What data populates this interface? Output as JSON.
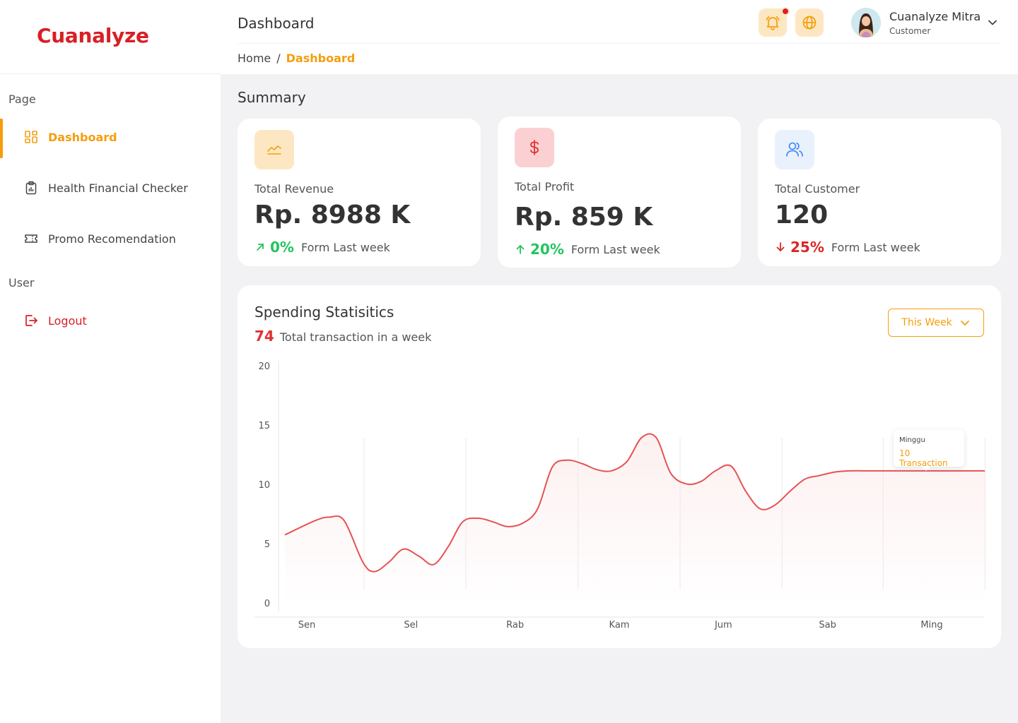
{
  "app": {
    "logo": "Cuanalyze"
  },
  "sidebar": {
    "page_section": "Page",
    "user_section": "User",
    "items": [
      {
        "label": "Dashboard",
        "icon": "dashboard-grid-icon",
        "active": true
      },
      {
        "label": "Health Financial Checker",
        "icon": "clipboard-icon"
      },
      {
        "label": "Promo Recomendation",
        "icon": "ticket-icon"
      }
    ],
    "logout": {
      "label": "Logout",
      "icon": "logout-icon"
    }
  },
  "header": {
    "title": "Dashboard",
    "breadcrumb": {
      "home": "Home",
      "separator": "/",
      "current": "Dashboard"
    },
    "user": {
      "name": "Cuanalyze Mitra",
      "role": "Customer"
    }
  },
  "summary": {
    "title": "Summary",
    "cards": [
      {
        "label": "Total Revenue",
        "value": "Rp. 8988 K",
        "change": "0%",
        "trend": "up",
        "note": "Form Last week",
        "icon": "chart-line-icon"
      },
      {
        "label": "Total Profit",
        "value": "Rp. 859 K",
        "change": "20%",
        "trend": "up",
        "note": "Form Last week",
        "icon": "dollar-icon"
      },
      {
        "label": "Total Customer",
        "value": "120",
        "change": "25%",
        "trend": "down",
        "note": "Form Last week",
        "icon": "users-icon"
      }
    ]
  },
  "stats": {
    "title": "Spending Statisitics",
    "total": "74",
    "total_label": "Total transaction in a week",
    "period": "This Week",
    "tooltip": {
      "day": "Minggu",
      "value": "10 Transaction"
    }
  },
  "colors": {
    "accent": "#f59e0b",
    "brand": "#d91f26",
    "line": "#e55353",
    "up": "#22c55e",
    "down": "#dc2626"
  },
  "chart_data": {
    "type": "line",
    "title": "Spending Statisitics",
    "categories": [
      "Sen",
      "Sel",
      "Rab",
      "Kam",
      "Jum",
      "Sab",
      "Ming"
    ],
    "y_ticks": [
      0,
      5,
      10,
      15,
      20
    ],
    "ylim": [
      0,
      20
    ],
    "series": [
      {
        "x": [
          0.0,
          0.29,
          0.43,
          0.57,
          0.75,
          0.86,
          1.0,
          1.14,
          1.29,
          1.43,
          1.57,
          1.71,
          1.86,
          2.0,
          2.14,
          2.29,
          2.43,
          2.57,
          2.71,
          2.86,
          3.0,
          3.14,
          3.29,
          3.43,
          3.57,
          3.71,
          3.86,
          4.0,
          4.14,
          4.29,
          4.43,
          4.57,
          4.71,
          4.86,
          5.0,
          5.14,
          5.29,
          5.43,
          5.57,
          5.71,
          5.86,
          6.0,
          6.14,
          6.29,
          6.43,
          6.57,
          6.73
        ],
        "values": [
          5.8,
          7.0,
          7.3,
          7.0,
          3.5,
          2.7,
          3.5,
          4.6,
          4.0,
          3.3,
          4.8,
          6.9,
          7.2,
          6.9,
          6.5,
          6.8,
          8.0,
          11.5,
          12.1,
          11.8,
          11.3,
          11.2,
          12.0,
          14.0,
          14.0,
          11.0,
          10.1,
          10.3,
          11.2,
          11.6,
          9.5,
          8.0,
          8.3,
          9.5,
          10.5,
          10.8,
          11.1,
          11.2,
          11.2,
          11.2,
          11.2,
          11.2,
          11.2,
          11.2,
          11.2,
          11.2,
          11.2
        ]
      }
    ],
    "grid": false,
    "legend": "none"
  }
}
